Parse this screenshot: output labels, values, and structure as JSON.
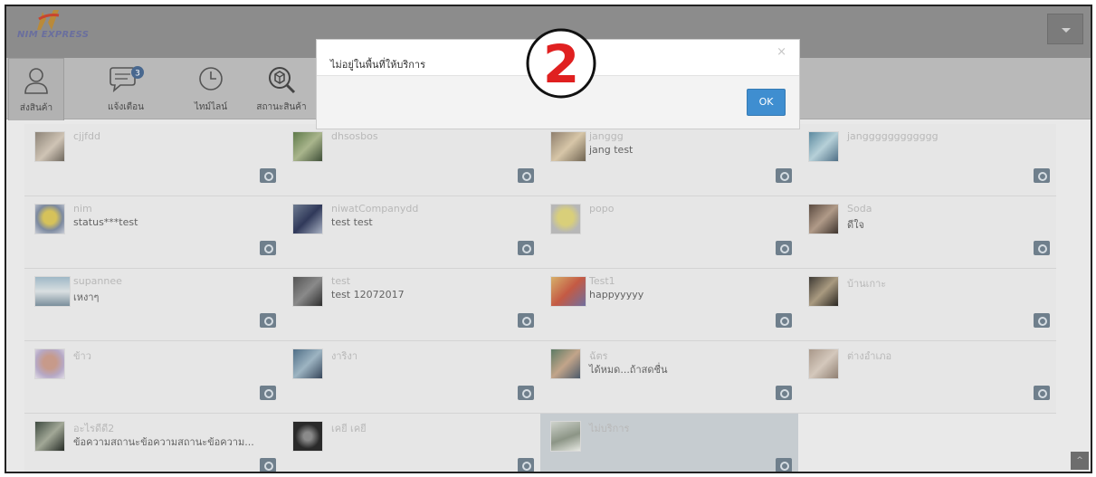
{
  "app": {
    "logo_text": "NIM EXPRESS",
    "colors": {
      "header": "#8c8c8c",
      "toolbar": "#b9b9b9",
      "overlay_bg": "#e9e9e9",
      "ok_button": "#3f8ed0",
      "gear": "#6f7f8c",
      "callout": "#e02020"
    }
  },
  "toolbar": {
    "items": [
      {
        "label": "ส่งสินค้า",
        "icon": "user-icon"
      },
      {
        "label": "แจ้งเตือน",
        "icon": "chat-bubble-icon",
        "badge": "3"
      },
      {
        "label": "ไทม์ไลน์",
        "icon": "clock-icon"
      },
      {
        "label": "สถานะสินค้า",
        "icon": "search-box-icon"
      }
    ]
  },
  "modal": {
    "title": "ไม่อยู่ในพื้นที่ให้บริการ",
    "close": "×",
    "ok_label": "OK",
    "callout_number": "2"
  },
  "users": [
    {
      "name": "cjjfdd",
      "status": ""
    },
    {
      "name": "dhsosbos",
      "status": ""
    },
    {
      "name": "janggg",
      "status": "jang test"
    },
    {
      "name": "jangggggggggggg",
      "status": ""
    },
    {
      "name": "nim",
      "status": "status***test"
    },
    {
      "name": "niwatCompanydd",
      "status": "test test"
    },
    {
      "name": "popo",
      "status": ""
    },
    {
      "name": "Soda",
      "status": "ดีใจ"
    },
    {
      "name": "supannee",
      "status": "เหงาๆ"
    },
    {
      "name": "test",
      "status": "test 12072017"
    },
    {
      "name": "Test1",
      "status": "happyyyyy"
    },
    {
      "name": "บ้านเกาะ",
      "status": ""
    },
    {
      "name": "ข้าว",
      "status": ""
    },
    {
      "name": "งาริงา",
      "status": ""
    },
    {
      "name": "ฉัตร",
      "status": "ได้หมด...ถ้าสดชื่น"
    },
    {
      "name": "ต่างอำเภอ",
      "status": ""
    },
    {
      "name": "อะไรดีดี2",
      "status": "ข้อความสถานะข้อความสถานะข้อความ..."
    },
    {
      "name": "เคยี เคยี",
      "status": ""
    },
    {
      "name": "ไม่บริการ",
      "status": ""
    }
  ],
  "scroll_top_label": "^"
}
